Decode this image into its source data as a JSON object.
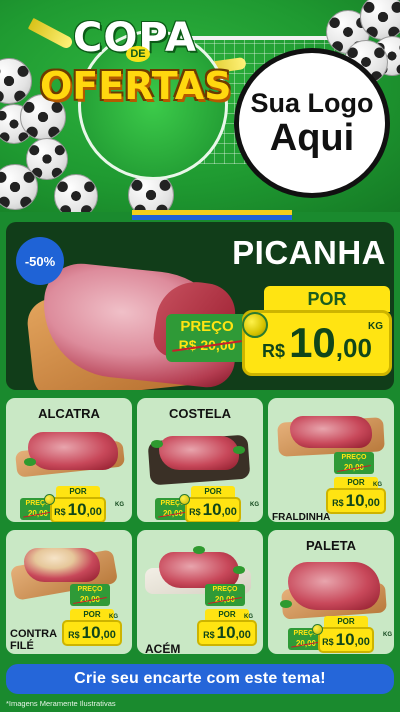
{
  "header": {
    "title_line1": "COPA",
    "title_connector": "DE",
    "title_line2": "OFERTAS",
    "logo_line1": "Sua Logo",
    "logo_line2": "Aqui"
  },
  "hero": {
    "product": "PICANHA",
    "discount": "-50%",
    "por_label": "POR",
    "preco_label": "PREÇO",
    "old_price": "R$ 20,00",
    "currency": "R$",
    "price_int": "10",
    "price_dec": ",00",
    "unit": "KG"
  },
  "cards": [
    {
      "name": "ALCATRA",
      "preco_label": "PREÇO",
      "old_price": "20,00",
      "por_label": "POR",
      "currency": "R$",
      "price_int": "10",
      "price_dec": ",00",
      "unit": "KG"
    },
    {
      "name": "COSTELA",
      "preco_label": "PREÇO",
      "old_price": "20,00",
      "por_label": "POR",
      "currency": "R$",
      "price_int": "10",
      "price_dec": ",00",
      "unit": "KG"
    },
    {
      "name": "FRALDINHA",
      "preco_label": "PREÇO",
      "old_price": "20,00",
      "por_label": "POR",
      "currency": "R$",
      "price_int": "10",
      "price_dec": ",00",
      "unit": "KG"
    },
    {
      "name_line1": "CONTRA",
      "name_line2": "FILÉ",
      "preco_label": "PREÇO",
      "old_price": "20,00",
      "por_label": "POR",
      "currency": "R$",
      "price_int": "10",
      "price_dec": ",00",
      "unit": "KG"
    },
    {
      "name": "ACÉM",
      "preco_label": "PREÇO",
      "old_price": "20,00",
      "por_label": "POR",
      "currency": "R$",
      "price_int": "10",
      "price_dec": ",00",
      "unit": "KG"
    },
    {
      "name": "PALETA",
      "preco_label": "PREÇO",
      "old_price": "20,00",
      "por_label": "POR",
      "currency": "R$",
      "price_int": "10",
      "price_dec": ",00",
      "unit": "KG"
    }
  ],
  "footer": {
    "cta": "Crie seu encarte com este tema!",
    "disclaimer": "*Imagens Meramente Ilustrativas"
  },
  "colors": {
    "background_green": "#1a8a2e",
    "card_bg": "#c9e8c5",
    "hero_bg": "#113d19",
    "price_yellow": "#ffe412",
    "preco_green": "#2f9a37",
    "badge_blue": "#1f63d6",
    "cta_blue": "#2566d9"
  }
}
